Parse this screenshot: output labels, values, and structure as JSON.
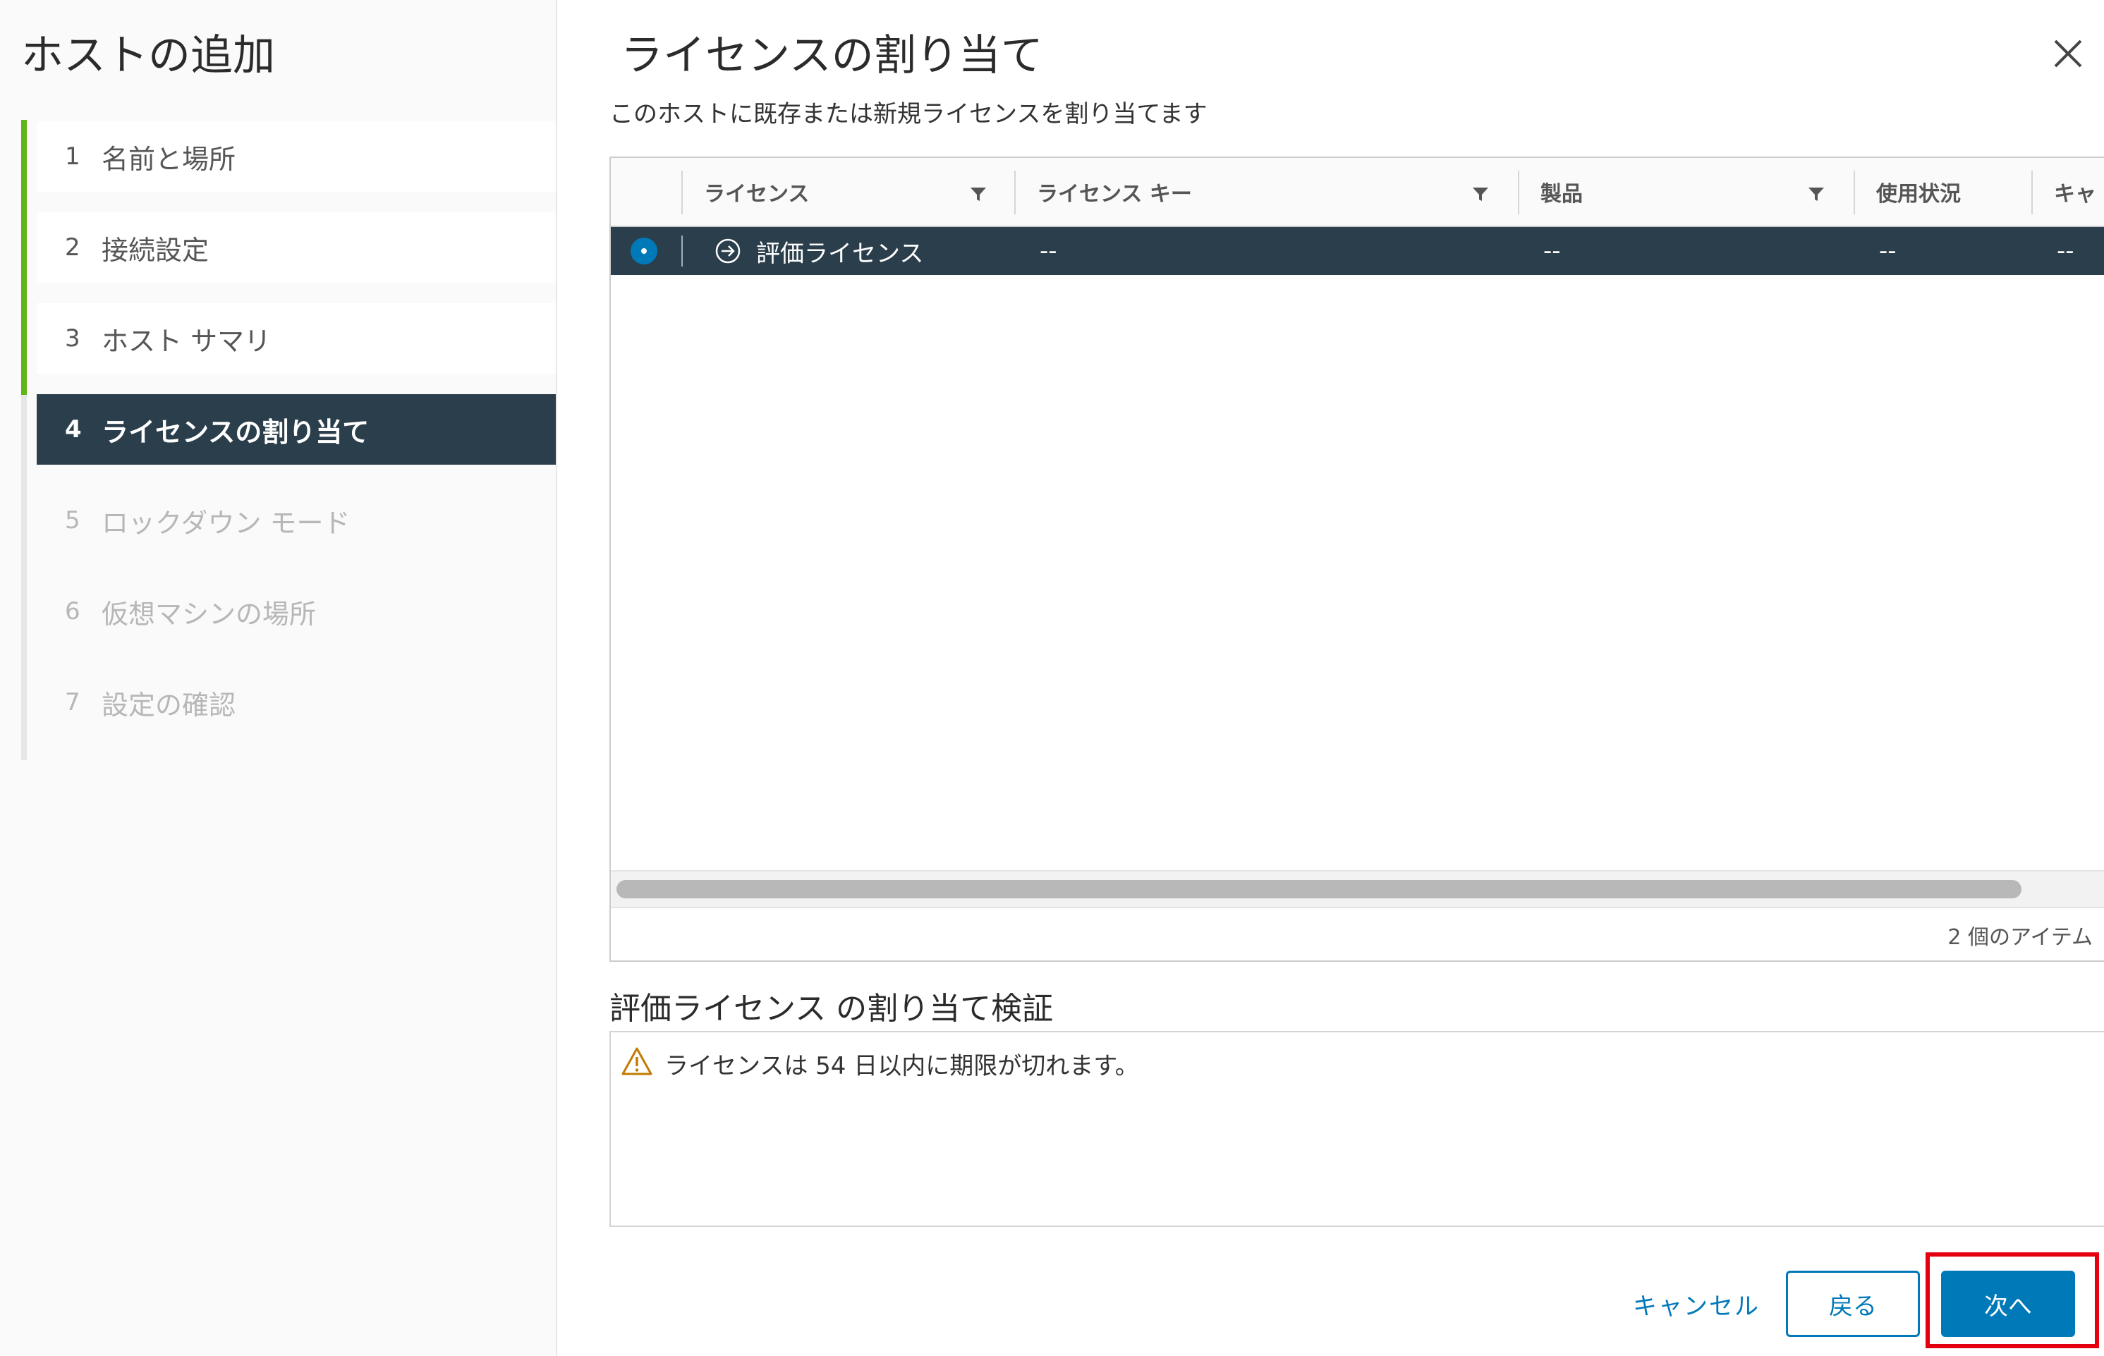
{
  "wizard": {
    "title": "ホストの追加",
    "steps": [
      {
        "num": "1",
        "label": "名前と場所",
        "state": "done"
      },
      {
        "num": "2",
        "label": "接続設定",
        "state": "done"
      },
      {
        "num": "3",
        "label": "ホスト サマリ",
        "state": "done"
      },
      {
        "num": "4",
        "label": "ライセンスの割り当て",
        "state": "active"
      },
      {
        "num": "5",
        "label": "ロックダウン モード",
        "state": "disabled"
      },
      {
        "num": "6",
        "label": "仮想マシンの場所",
        "state": "disabled"
      },
      {
        "num": "7",
        "label": "設定の確認",
        "state": "disabled"
      }
    ]
  },
  "main": {
    "title": "ライセンスの割り当て",
    "subtitle": "このホストに既存または新規ライセンスを割り当てます"
  },
  "grid": {
    "columns": [
      {
        "label": "ライセンス",
        "filterable": true
      },
      {
        "label": "ライセンス キー",
        "filterable": true
      },
      {
        "label": "製品",
        "filterable": true
      },
      {
        "label": "使用状況",
        "filterable": false
      },
      {
        "label": "キャ",
        "filterable": false
      }
    ],
    "rows": [
      {
        "license": "評価ライセンス",
        "key": "--",
        "product": "--",
        "usage": "--",
        "capacity": "--",
        "selected": true
      }
    ],
    "footer": "2 個のアイテム"
  },
  "validation": {
    "title": "評価ライセンス の割り当て検証",
    "message": "ライセンスは 54 日以内に期限が切れます。"
  },
  "buttons": {
    "cancel": "キャンセル",
    "back": "戻る",
    "next": "次へ"
  },
  "colors": {
    "accent": "#0079b8",
    "nav_active": "#2b3e4b",
    "step_done": "#60b515",
    "warning": "#c27b00",
    "highlight": "#e4000f"
  },
  "icons": {
    "close": "close-icon",
    "filter": "filter-icon",
    "row_detail": "arrow-circle-right-icon",
    "warning": "warning-triangle-icon"
  }
}
